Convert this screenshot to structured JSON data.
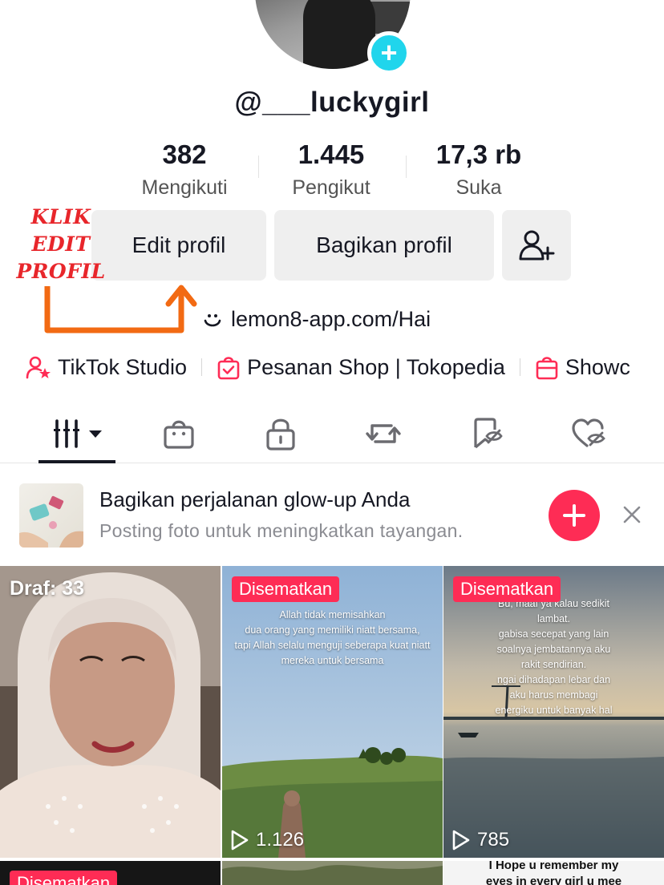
{
  "profile": {
    "username": "@___luckygirl",
    "stats": [
      {
        "value": "382",
        "label": "Mengikuti"
      },
      {
        "value": "1.445",
        "label": "Pengikut"
      },
      {
        "value": "17,3 rb",
        "label": "Suka"
      }
    ],
    "buttons": {
      "edit": "Edit profil",
      "share": "Bagikan profil"
    },
    "link": "lemon8-app.com/Hai"
  },
  "annotation": {
    "line1": "KLIK EDIT",
    "line2": "PROFIL"
  },
  "shortcuts": [
    {
      "label": "TikTok Studio",
      "icon": "person-star-icon"
    },
    {
      "label": "Pesanan Shop | Tokopedia",
      "icon": "shopping-bag-check-icon"
    },
    {
      "label": "Showc",
      "icon": "shopping-bag-icon"
    }
  ],
  "tabs": [
    {
      "name": "videos-grid",
      "icon": "grid-bars-icon",
      "active": true
    },
    {
      "name": "shop",
      "icon": "shopping-bag-icon"
    },
    {
      "name": "private",
      "icon": "lock-icon"
    },
    {
      "name": "reposts",
      "icon": "repost-icon"
    },
    {
      "name": "favorites",
      "icon": "bookmark-hidden-icon"
    },
    {
      "name": "liked",
      "icon": "heart-hidden-icon"
    }
  ],
  "promo": {
    "title": "Bagikan perjalanan glow-up Anda",
    "subtitle": "Posting foto untuk meningkatkan tayangan."
  },
  "grid": {
    "tiles": [
      {
        "label": "Draf: 33"
      },
      {
        "badge": "Disematkan",
        "views": "1.126",
        "caption": [
          "Allah tidak memisahkan",
          "dua orang yang memiliki niatt bersama,",
          "tapi Allah selalu menguji seberapa kuat niatt",
          "mereka untuk bersama"
        ]
      },
      {
        "badge": "Disematkan",
        "views": "785",
        "caption": [
          "Bu, maaf ya kalau sedikit",
          "lambat.",
          "gabisa secepat yang lain",
          "soalnya jembatannya aku",
          "rakit sendirian.",
          "ngai dihadapan lebar dan",
          "aku harus membagi",
          "energiku untuk banyak hal"
        ]
      },
      {
        "badge": "Disematkan"
      },
      {},
      {
        "caption": [
          "I Hope u remember my",
          "eyes in every girl u mee"
        ]
      }
    ]
  },
  "colors": {
    "accent": "#fe2c55",
    "badge_plus": "#20d5ec",
    "annotation": "#e8262b",
    "arrow": "#f26a13"
  }
}
